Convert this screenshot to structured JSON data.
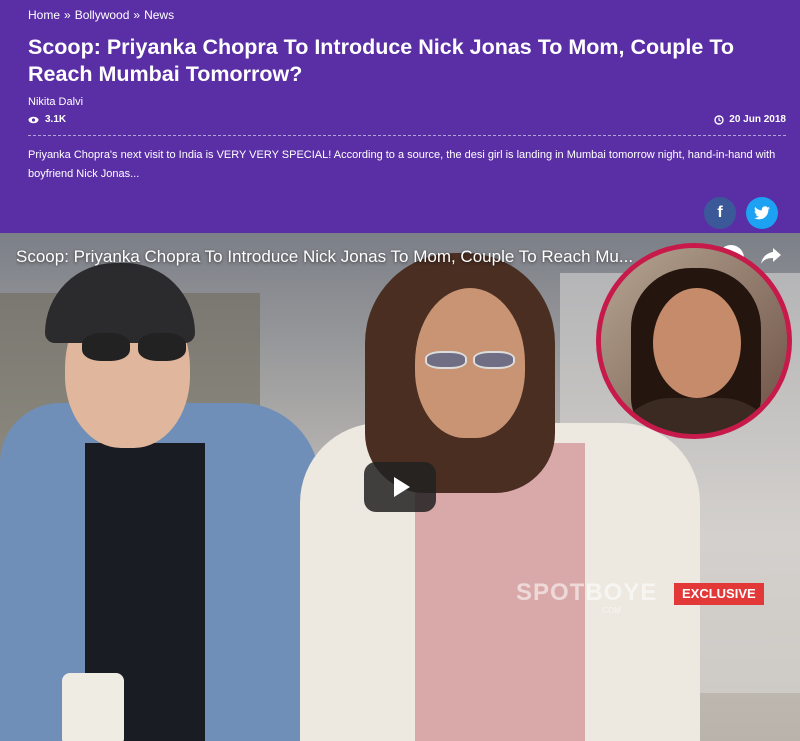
{
  "breadcrumb": {
    "items": [
      "Home",
      "Bollywood",
      "News"
    ],
    "separator": "»"
  },
  "article": {
    "title": "Scoop: Priyanka Chopra To Introduce Nick Jonas To Mom, Couple To Reach Mumbai Tomorrow?",
    "author": "Nikita Dalvi",
    "views": "3.1K",
    "date": "20 Jun 2018",
    "summary": "Priyanka Chopra's next visit to India is VERY VERY SPECIAL! According to a source, the desi girl is landing in Mumbai tomorrow night, hand-in-hand with boyfriend Nick Jonas..."
  },
  "share": {
    "facebook_icon": "f",
    "twitter_icon": "twitter-bird"
  },
  "video": {
    "title": "Scoop: Priyanka Chopra To Introduce Nick Jonas To Mom, Couple To Reach Mu...",
    "watermark": "SPOTBOYE",
    "watermark_sub": ".COM",
    "badge": "EXCLUSIVE"
  },
  "colors": {
    "header_bg": "#5a2fa6",
    "facebook": "#3b5998",
    "twitter": "#1da1f2",
    "inset_border": "#c8194b",
    "exclusive": "#e23838"
  }
}
